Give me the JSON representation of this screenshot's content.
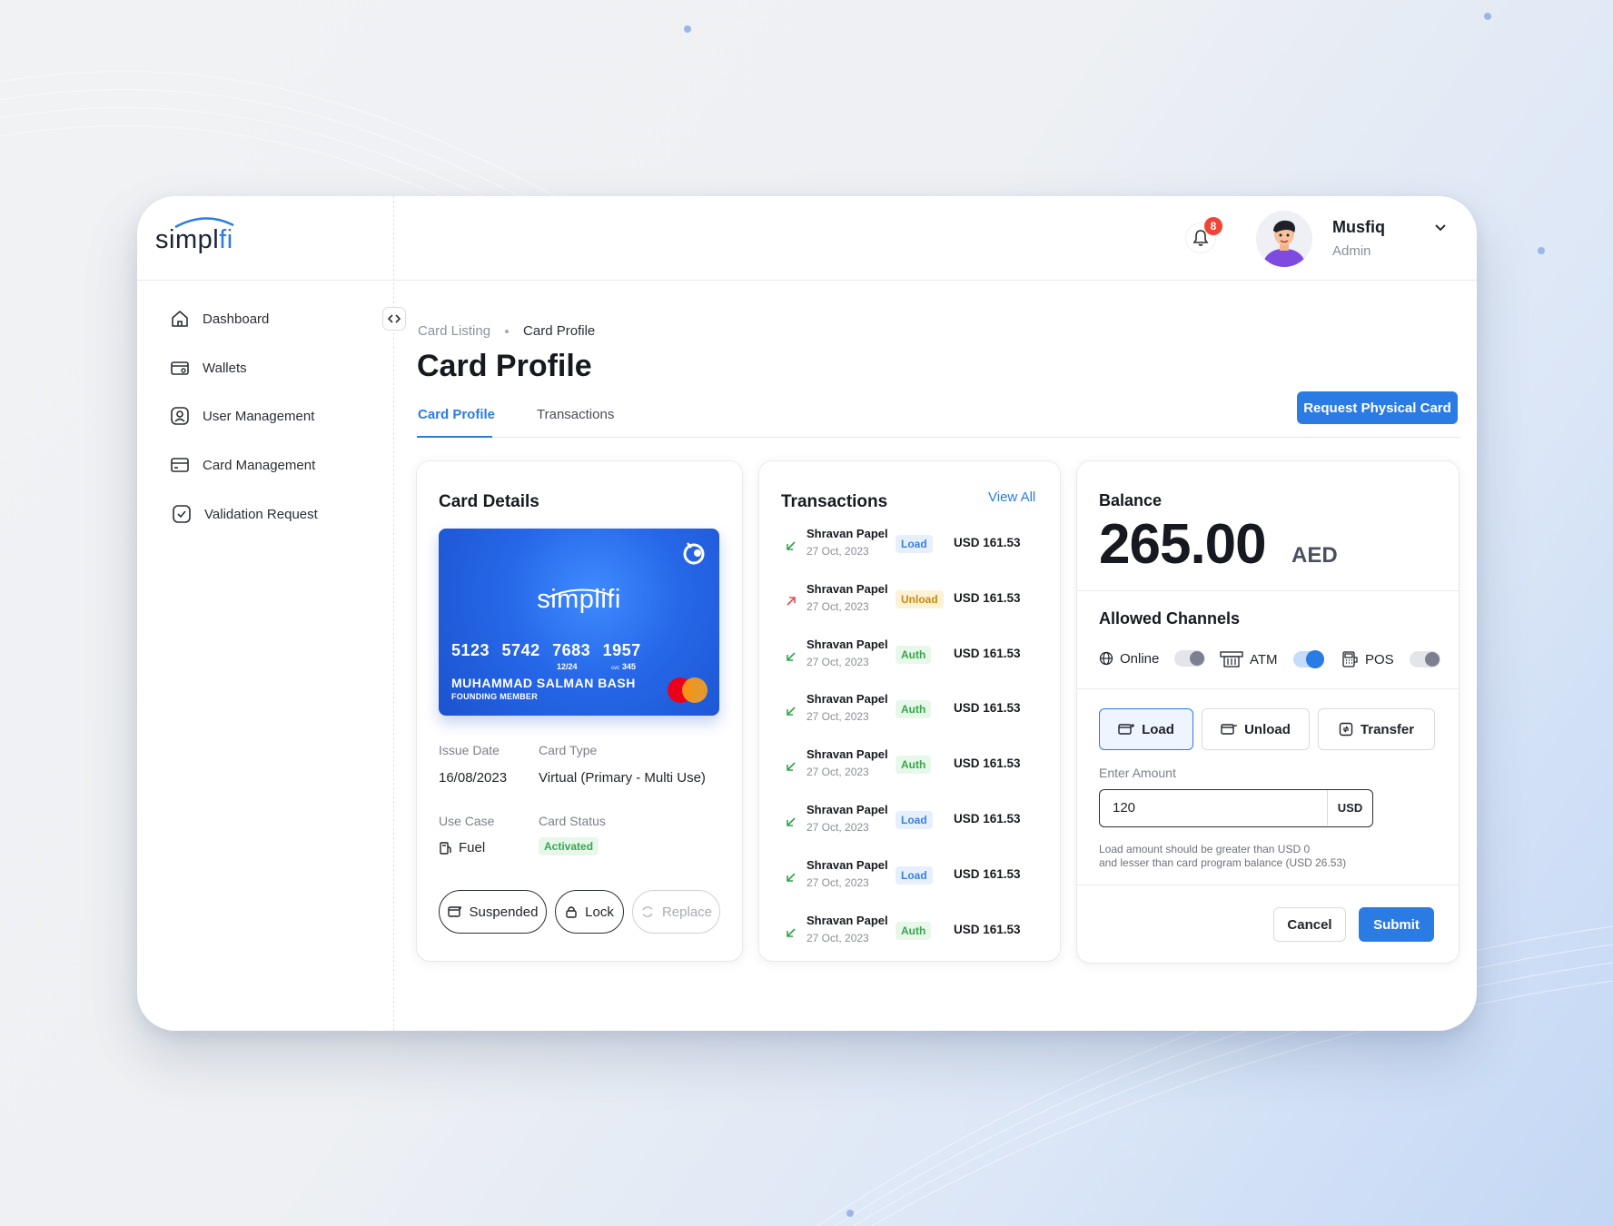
{
  "brand": {
    "logo_text": "simpl",
    "logo_accent": "fi",
    "accent_color": "#2b7be5"
  },
  "header": {
    "notification_count": "8",
    "user_name": "Musfiq",
    "user_role": "Admin"
  },
  "sidebar": {
    "items": [
      {
        "label": "Dashboard",
        "icon": "home-icon"
      },
      {
        "label": "Wallets",
        "icon": "wallet-icon"
      },
      {
        "label": "User Management",
        "icon": "user-icon"
      },
      {
        "label": "Card Management",
        "icon": "card-icon"
      },
      {
        "label": "Validation Request",
        "icon": "check-icon"
      }
    ]
  },
  "breadcrumb": {
    "parent": "Card Listing",
    "current": "Card Profile"
  },
  "page": {
    "title": "Card Profile",
    "request_button": "Request Physical Card"
  },
  "tabs": [
    {
      "label": "Card Profile",
      "active": true
    },
    {
      "label": "Transactions",
      "active": false
    }
  ],
  "card_details": {
    "title": "Card Details",
    "card": {
      "logo_text": "simplifi",
      "number": "5123 5742 7683 1957",
      "expiry": "12/24",
      "cvc_label": "cvc",
      "cvc": "345",
      "holder": "MUHAMMAD SALMAN BASH",
      "member": "FOUNDING MEMBER"
    },
    "issue_date_label": "Issue Date",
    "issue_date": "16/08/2023",
    "card_type_label": "Card Type",
    "card_type": "Virtual (Primary - Multi Use)",
    "use_case_label": "Use Case",
    "use_case": "Fuel",
    "status_label": "Card Status",
    "status": "Activated",
    "actions": {
      "suspended": "Suspended",
      "lock": "Lock",
      "replace": "Replace"
    }
  },
  "transactions": {
    "title": "Transactions",
    "view_all": "View All",
    "rows": [
      {
        "name": "Shravan Papel",
        "date": "27 Oct, 2023",
        "type": "Load",
        "amount": "USD 161.53",
        "direction": "in"
      },
      {
        "name": "Shravan Papel",
        "date": "27 Oct, 2023",
        "type": "Unload",
        "amount": "USD 161.53",
        "direction": "out"
      },
      {
        "name": "Shravan Papel",
        "date": "27 Oct, 2023",
        "type": "Auth",
        "amount": "USD 161.53",
        "direction": "in"
      },
      {
        "name": "Shravan Papel",
        "date": "27 Oct, 2023",
        "type": "Auth",
        "amount": "USD 161.53",
        "direction": "in"
      },
      {
        "name": "Shravan Papel",
        "date": "27 Oct, 2023",
        "type": "Auth",
        "amount": "USD 161.53",
        "direction": "in"
      },
      {
        "name": "Shravan Papel",
        "date": "27 Oct, 2023",
        "type": "Load",
        "amount": "USD 161.53",
        "direction": "in"
      },
      {
        "name": "Shravan Papel",
        "date": "27 Oct, 2023",
        "type": "Load",
        "amount": "USD 161.53",
        "direction": "in"
      },
      {
        "name": "Shravan Papel",
        "date": "27 Oct, 2023",
        "type": "Auth",
        "amount": "USD 161.53",
        "direction": "in"
      }
    ]
  },
  "balance": {
    "title": "Balance",
    "amount": "265.00",
    "currency": "AED",
    "channels_title": "Allowed Channels",
    "channels": [
      {
        "label": "Online",
        "enabled": false
      },
      {
        "label": "ATM",
        "enabled": true
      },
      {
        "label": "POS",
        "enabled": false
      }
    ],
    "operations": {
      "load": "Load",
      "unload": "Unload",
      "transfer": "Transfer",
      "selected": "Load"
    },
    "amount_label": "Enter Amount",
    "amount_value": "120",
    "amount_currency": "USD",
    "hint_line1": "Load amount should be greater than USD 0",
    "hint_line2": "and lesser than card program balance (USD 26.53)",
    "cancel": "Cancel",
    "submit": "Submit"
  }
}
